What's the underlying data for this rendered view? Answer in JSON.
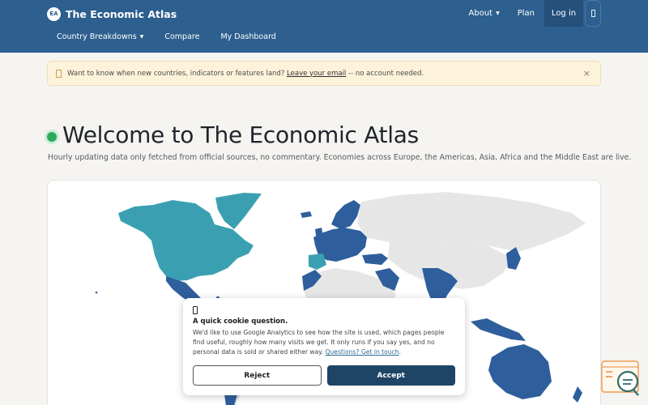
{
  "header": {
    "brand_logo": "EA",
    "brand_name": "The Economic Atlas",
    "about_label": "About",
    "plan_label": "Plan",
    "login_label": "Log in",
    "menu_icon": "menu-icon",
    "sub_nav": [
      {
        "label": "Country Breakdowns",
        "has_caret": true
      },
      {
        "label": "Compare"
      },
      {
        "label": "My Dashboard"
      }
    ]
  },
  "notice": {
    "icon": "mail-icon",
    "text_before": "Want to know when new countries, indicators or features land?",
    "link_text": "Leave your email",
    "text_after": "-- no account needed.",
    "close_symbol": "×"
  },
  "hero": {
    "title": "Welcome to The Economic Atlas",
    "subtitle": "Hourly updating data only fetched from official sources, no commentary. Economies across Europe, the Americas, Asia, Africa and the Middle East are live."
  },
  "map": {
    "colors": {
      "americas": "#3aa0b1",
      "covered": "#2e5f9c",
      "uncovered": "#e6e6e6"
    }
  },
  "cookie": {
    "icon": "cookie-icon",
    "title": "A quick cookie question.",
    "body": "We'd like to use Google Analytics to see how the site is used, which pages people find useful, roughly how many visits we get. It only runs if you say yes, and no personal data is sold or shared either way.",
    "link_text": "Questions? Get in touch",
    "reject_label": "Reject",
    "accept_label": "Accept"
  },
  "colors": {
    "header_bg": "#2d5f8f",
    "accent_dark": "#1f4566",
    "live_green": "#2eaa5c",
    "help_orange": "#e8893a",
    "help_teal": "#2f6f6a"
  }
}
